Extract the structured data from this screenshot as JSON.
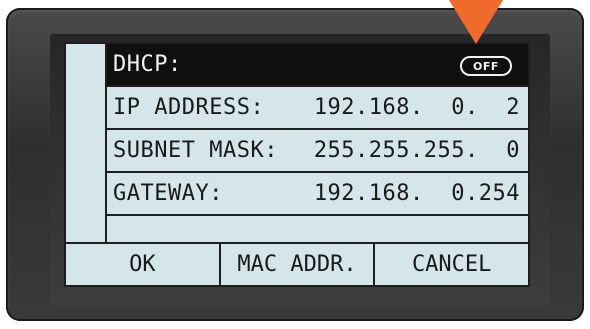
{
  "rows": [
    {
      "label": "DHCP:",
      "value": "OFF",
      "selected": true
    },
    {
      "label": "IP ADDRESS:",
      "value": "192.168.  0.  2"
    },
    {
      "label": "SUBNET MASK:",
      "value": "255.255.255.  0"
    },
    {
      "label": "GATEWAY:",
      "value": "192.168.  0.254"
    }
  ],
  "softkeys": {
    "ok": "OK",
    "mac": "MAC ADDR.",
    "cancel": "CANCEL"
  },
  "colors": {
    "lcd_background": "#d4e6ea",
    "selection": "#0f0f0f",
    "pointer": "#f06a2c",
    "bezel": "#3a3a3a"
  },
  "icons": {
    "pointer": "down-triangle-indicator"
  }
}
